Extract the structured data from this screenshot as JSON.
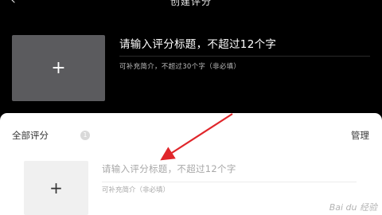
{
  "header": {
    "title": "创建评分"
  },
  "create": {
    "title_placeholder": "请输入评分标题，不超过12个字",
    "intro_placeholder": "可补充简介，不超过30个字（非必填）",
    "add_symbol": "+"
  },
  "panel": {
    "heading": "全部评分",
    "count": "1",
    "manage_label": "管理",
    "card": {
      "add_symbol": "+",
      "title_placeholder": "请输入评分标题，不超过12个字",
      "intro_placeholder": "可补充简介（非必填）"
    }
  },
  "annotation": {
    "arrow_color": "#e0262b"
  },
  "watermark": {
    "text": "Bai du 经验"
  }
}
